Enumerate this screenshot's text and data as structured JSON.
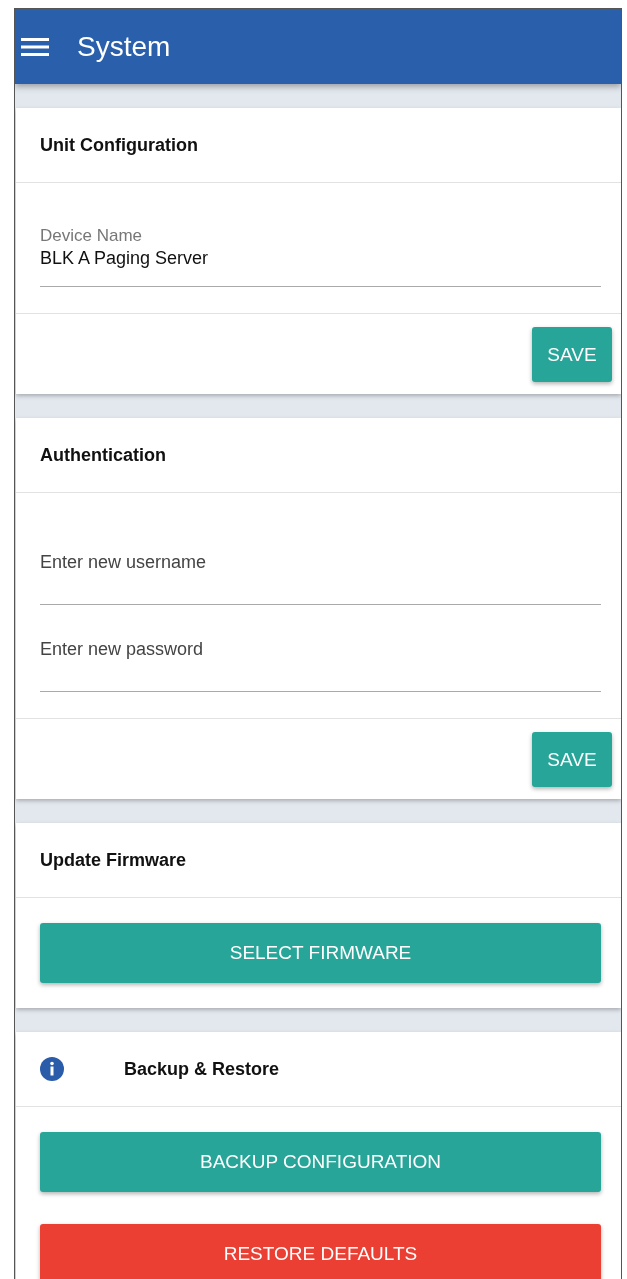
{
  "app_bar": {
    "title": "System"
  },
  "sections": [
    {
      "title": "Unit Configuration",
      "fields": [
        {
          "label": "Device Name",
          "value": "BLK A Paging Server"
        }
      ],
      "footer_buttons": [
        {
          "label": "SAVE",
          "kind": "primary"
        }
      ]
    },
    {
      "title": "Authentication",
      "fields": [
        {
          "placeholder": "Enter new username"
        },
        {
          "placeholder": "Enter new password"
        }
      ],
      "footer_buttons": [
        {
          "label": "SAVE",
          "kind": "primary"
        }
      ]
    },
    {
      "title": "Update Firmware",
      "body_buttons": [
        {
          "label": "SELECT FIRMWARE",
          "kind": "primary"
        }
      ]
    },
    {
      "title": "Backup & Restore",
      "info_icon": true,
      "body_buttons": [
        {
          "label": "BACKUP CONFIGURATION",
          "kind": "primary"
        },
        {
          "label": "RESTORE DEFAULTS",
          "kind": "danger"
        }
      ]
    }
  ]
}
